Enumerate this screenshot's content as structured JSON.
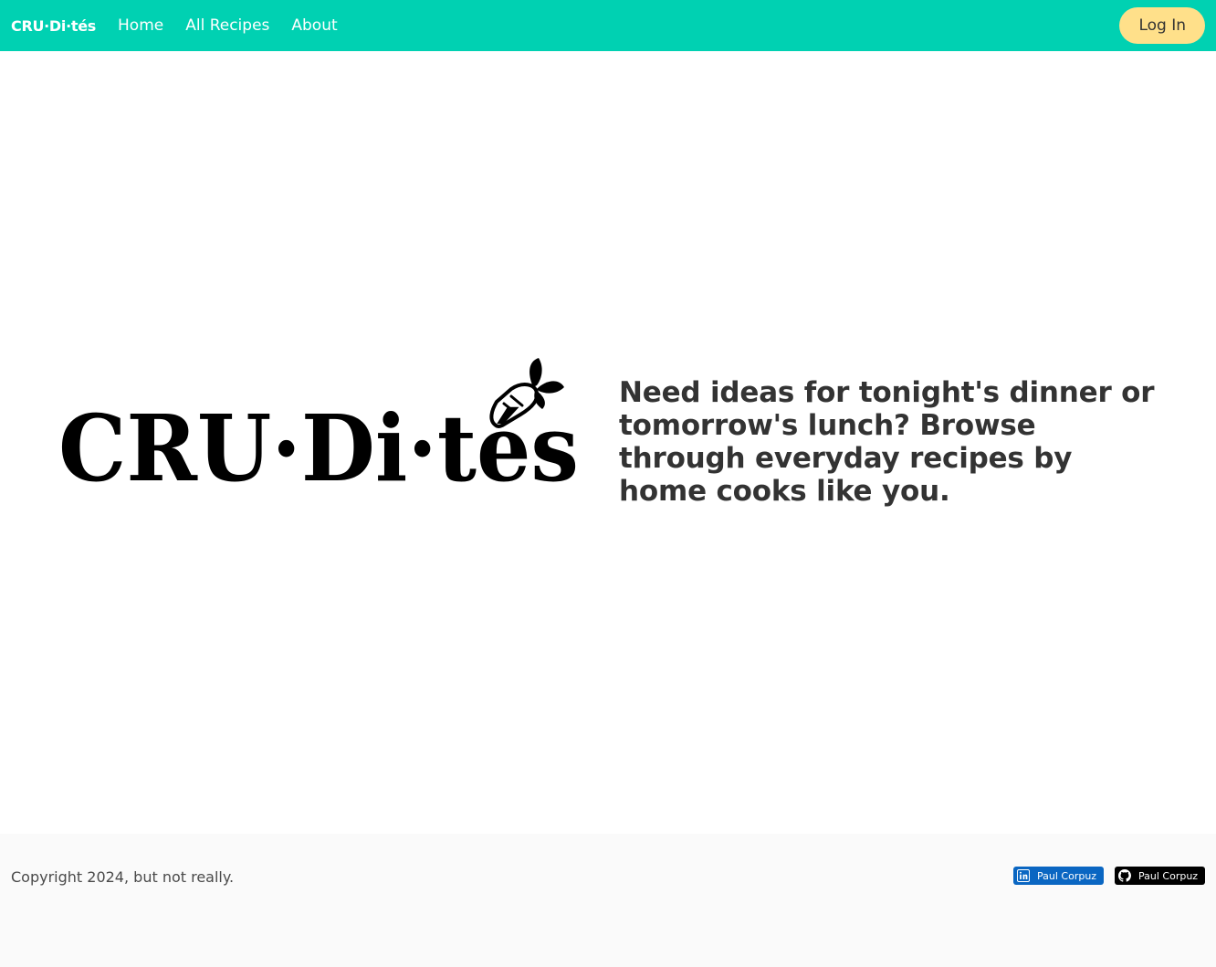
{
  "navbar": {
    "brand": "CRU·Di·tés",
    "links": [
      "Home",
      "All Recipes",
      "About"
    ],
    "login_label": "Log In",
    "background_color": "#00d1b2",
    "login_color": "#ffe08a"
  },
  "hero": {
    "logo_text": "CRU·Di·tés",
    "logo_icon": "carrot-icon",
    "tagline": "Need ideas for tonight's dinner or tomorrow's lunch? Browse through everyday recipes by home cooks like you."
  },
  "footer": {
    "copyright": "Copyright 2024, but not really.",
    "badges": [
      {
        "icon": "linkedin-icon",
        "label": "Paul Corpuz",
        "color": "#0a66c2"
      },
      {
        "icon": "github-icon",
        "label": "Paul Corpuz",
        "color": "#000000"
      }
    ]
  }
}
